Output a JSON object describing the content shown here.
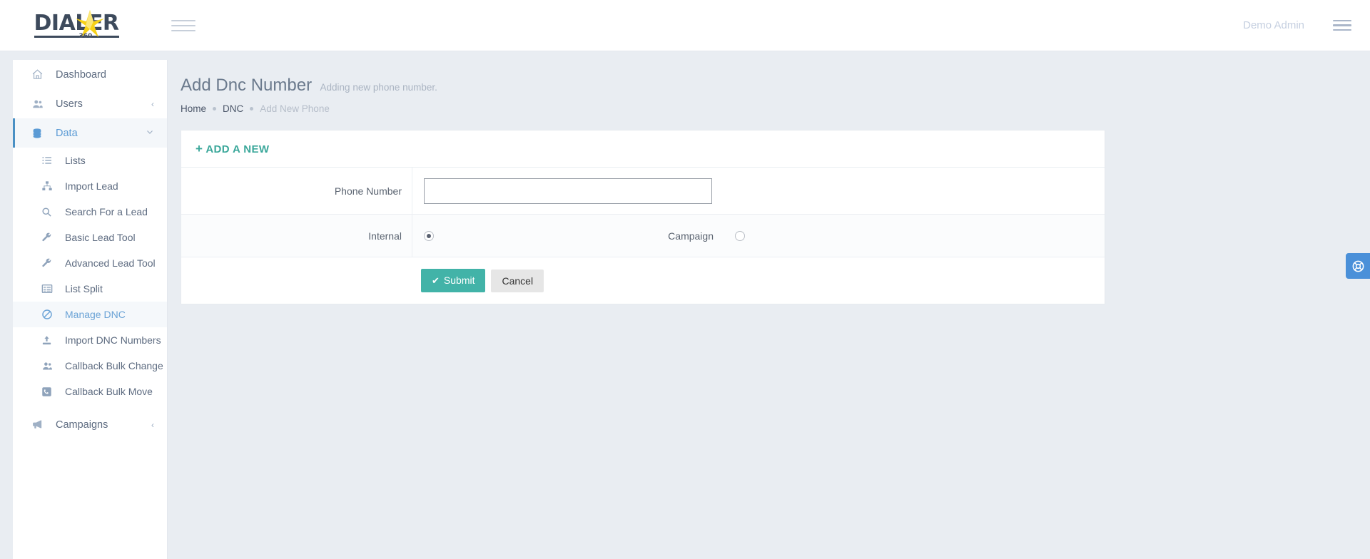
{
  "brand": {
    "name": "DIALER",
    "sub": "360"
  },
  "topbar": {
    "menu_toggle_icon": "hamburger-icon",
    "username": "Demo Admin",
    "right_menu_icon": "hamburger-icon"
  },
  "sidebar": {
    "items": [
      {
        "label": "Dashboard",
        "icon": "home-icon",
        "type": "main",
        "active": false,
        "chevron": ""
      },
      {
        "label": "Users",
        "icon": "users-icon",
        "type": "main",
        "active": false,
        "chevron": "‹"
      },
      {
        "label": "Data",
        "icon": "database-icon",
        "type": "main",
        "active": true,
        "chevron": "⌄"
      },
      {
        "label": "Lists",
        "icon": "list-icon",
        "type": "sub",
        "active": false
      },
      {
        "label": "Import Lead",
        "icon": "sitemap-icon",
        "type": "sub",
        "active": false
      },
      {
        "label": "Search For a Lead",
        "icon": "search-icon",
        "type": "sub",
        "active": false
      },
      {
        "label": "Basic Lead Tool",
        "icon": "wrench-icon",
        "type": "sub",
        "active": false
      },
      {
        "label": "Advanced Lead Tool",
        "icon": "wrench-icon",
        "type": "sub",
        "active": false
      },
      {
        "label": "List Split",
        "icon": "table-icon",
        "type": "sub",
        "active": false
      },
      {
        "label": "Manage DNC",
        "icon": "ban-icon",
        "type": "sub",
        "active": true
      },
      {
        "label": "Import DNC Numbers",
        "icon": "upload-icon",
        "type": "sub",
        "active": false
      },
      {
        "label": "Callback Bulk Change",
        "icon": "users-icon",
        "type": "sub",
        "active": false
      },
      {
        "label": "Callback Bulk Move",
        "icon": "phone-icon",
        "type": "sub",
        "active": false
      },
      {
        "label": "Campaigns",
        "icon": "megaphone-icon",
        "type": "main",
        "active": false,
        "chevron": "‹"
      }
    ]
  },
  "page": {
    "title": "Add Dnc Number",
    "subtitle": "Adding new phone number.",
    "breadcrumb": {
      "home": "Home",
      "section": "DNC",
      "current": "Add New Phone"
    }
  },
  "card": {
    "header_label": "ADD A NEW",
    "header_plus": "+",
    "form": {
      "phone_label": "Phone Number",
      "phone_value": "",
      "phone_placeholder": "",
      "internal_label": "Internal",
      "internal_checked": true,
      "campaign_label": "Campaign",
      "campaign_checked": false
    },
    "buttons": {
      "submit_label": "Submit",
      "submit_icon": "check-icon",
      "cancel_label": "Cancel"
    }
  },
  "support_widget": {
    "icon": "lifebuoy-icon"
  },
  "colors": {
    "accent_teal": "#42b3a8",
    "accent_blue": "#5b9bd5",
    "support_blue": "#4a90d9",
    "page_bg": "#e9edf2"
  }
}
